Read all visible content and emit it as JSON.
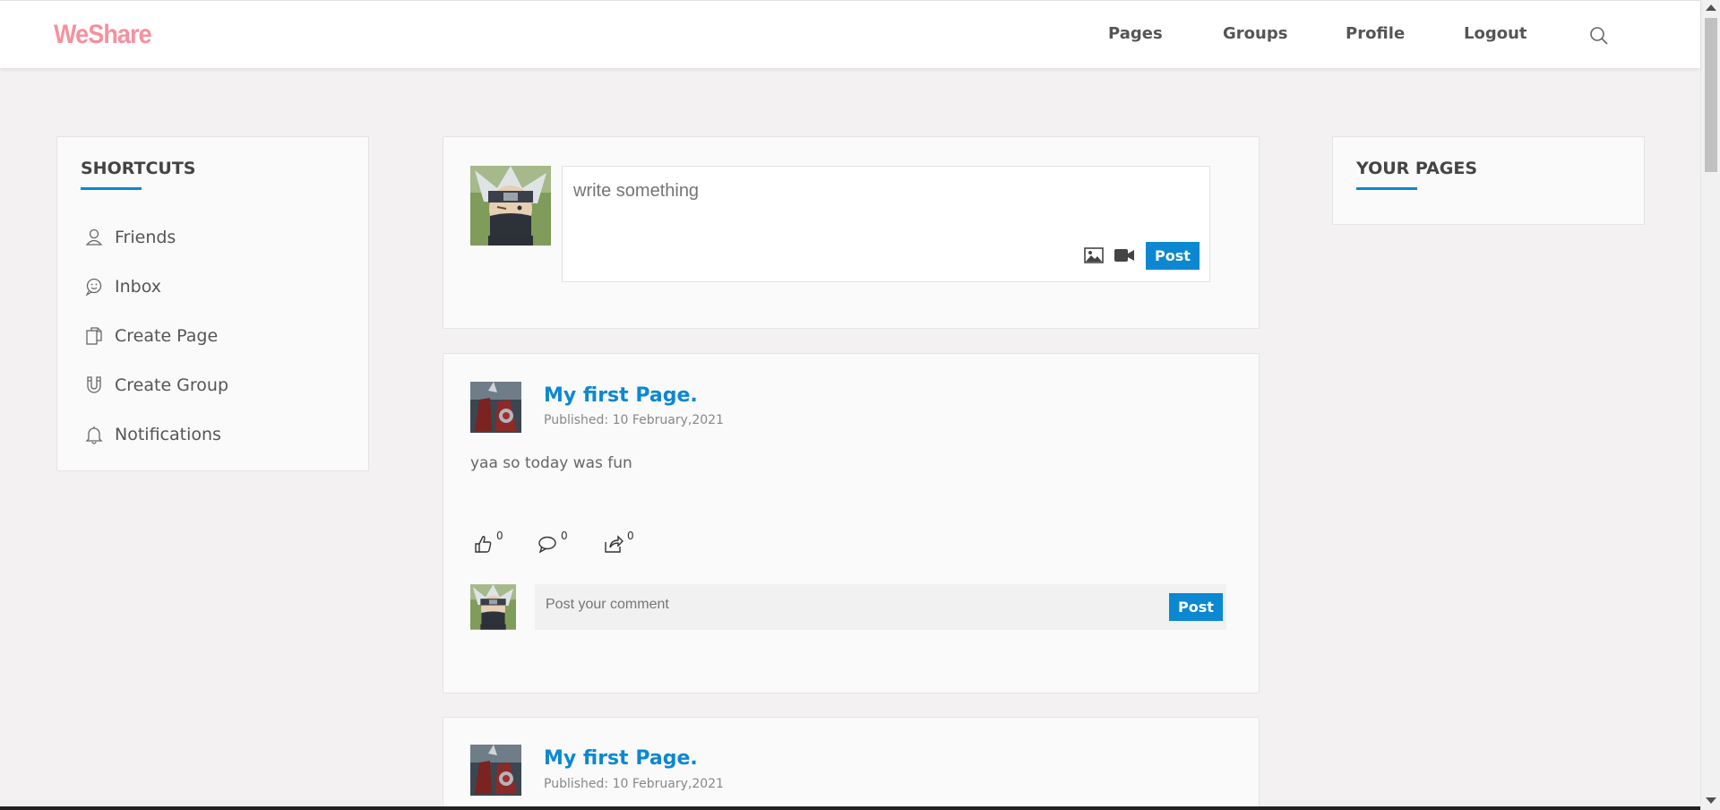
{
  "header": {
    "logo": "WeShare",
    "nav": [
      "Pages",
      "Groups",
      "Profile",
      "Logout"
    ]
  },
  "shortcuts": {
    "title": "SHORTCUTS",
    "items": [
      {
        "label": "Friends",
        "icon": "user-icon"
      },
      {
        "label": "Inbox",
        "icon": "chat-icon"
      },
      {
        "label": "Create Page",
        "icon": "copy-page-icon"
      },
      {
        "label": "Create Group",
        "icon": "magnet-icon"
      },
      {
        "label": "Notifications",
        "icon": "bell-icon"
      }
    ]
  },
  "composer": {
    "placeholder": "write something",
    "post_label": "Post"
  },
  "posts": [
    {
      "page_name": "My first Page.",
      "published": "Published: 10 February,2021",
      "body": "yaa so today was fun",
      "likes": "0",
      "comments": "0",
      "shares": "0",
      "comment_placeholder": "Post your comment",
      "comment_post_label": "Post"
    },
    {
      "page_name": "My first Page.",
      "published": "Published: 10 February,2021"
    }
  ],
  "your_pages": {
    "title": "YOUR PAGES"
  },
  "colors": {
    "accent": "#0b88d1",
    "logo": "#f6909d",
    "background": "#f3f1f2"
  }
}
